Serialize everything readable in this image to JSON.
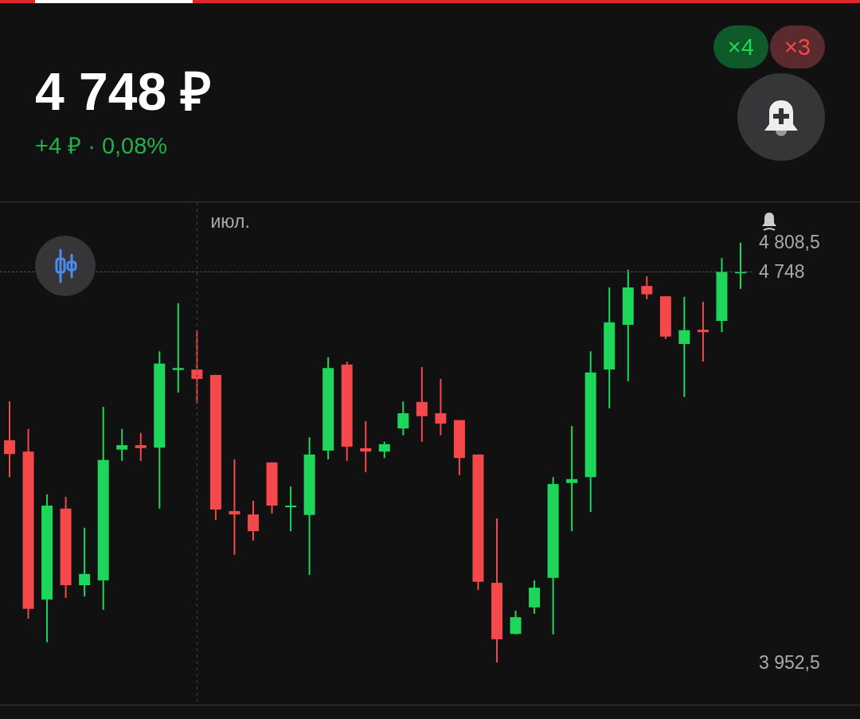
{
  "quote": {
    "price": "4 748 ₽",
    "change": "+4 ₽ · 0,08%"
  },
  "badges": [
    {
      "label": "×4",
      "kind": "up"
    },
    {
      "label": "×3",
      "kind": "down"
    }
  ],
  "chart": {
    "month_label": "июл.",
    "chart_data": {
      "type": "candlestick",
      "ohlc": [
        [
          4405,
          4484,
          4330,
          4377
        ],
        [
          4382,
          4428,
          4042,
          4062
        ],
        [
          4081,
          4295,
          3994,
          4272
        ],
        [
          4266,
          4290,
          4084,
          4110
        ],
        [
          4110,
          4227,
          4087,
          4133
        ],
        [
          4120,
          4473,
          4060,
          4365
        ],
        [
          4386,
          4428,
          4363,
          4395
        ],
        [
          4395,
          4420,
          4363,
          4389
        ],
        [
          4390,
          4586,
          4266,
          4561
        ],
        [
          4548,
          4684,
          4502,
          4552
        ],
        [
          4549,
          4629,
          4480,
          4530
        ],
        [
          4538,
          4538,
          4243,
          4264
        ],
        [
          4261,
          4366,
          4172,
          4254
        ],
        [
          4254,
          4282,
          4201,
          4220
        ],
        [
          4360,
          4360,
          4256,
          4272
        ],
        [
          4269,
          4311,
          4220,
          4272
        ],
        [
          4253,
          4411,
          4131,
          4376
        ],
        [
          4384,
          4574,
          4366,
          4552
        ],
        [
          4559,
          4565,
          4363,
          4392
        ],
        [
          4389,
          4444,
          4340,
          4382
        ],
        [
          4382,
          4402,
          4369,
          4397
        ],
        [
          4429,
          4484,
          4415,
          4460
        ],
        [
          4483,
          4554,
          4402,
          4454
        ],
        [
          4460,
          4530,
          4415,
          4439
        ],
        [
          4446,
          4446,
          4334,
          4369
        ],
        [
          4376,
          4376,
          4100,
          4117
        ],
        [
          4115,
          4246,
          3953,
          4000
        ],
        [
          4011,
          4058,
          4010,
          4045
        ],
        [
          4065,
          4120,
          4052,
          4105
        ],
        [
          4125,
          4330,
          4010,
          4316
        ],
        [
          4318,
          4434,
          4220,
          4326
        ],
        [
          4330,
          4586,
          4259,
          4543
        ],
        [
          4549,
          4716,
          4470,
          4645
        ],
        [
          4640,
          4752,
          4525,
          4716
        ],
        [
          4719,
          4739,
          4692,
          4702
        ],
        [
          4698,
          4698,
          4611,
          4616
        ],
        [
          4601,
          4697,
          4493,
          4629
        ],
        [
          4630,
          4687,
          4565,
          4625
        ],
        [
          4648,
          4776,
          4625,
          4748
        ],
        [
          4745,
          4807,
          4713,
          4748
        ]
      ],
      "ylim": [
        3867,
        4891
      ],
      "yticks": [
        {
          "value": 4808.5,
          "label": "4 808,5"
        },
        {
          "value": 4748,
          "label": "4 748"
        },
        {
          "value": 3952.5,
          "label": "3 952,5"
        }
      ]
    }
  }
}
